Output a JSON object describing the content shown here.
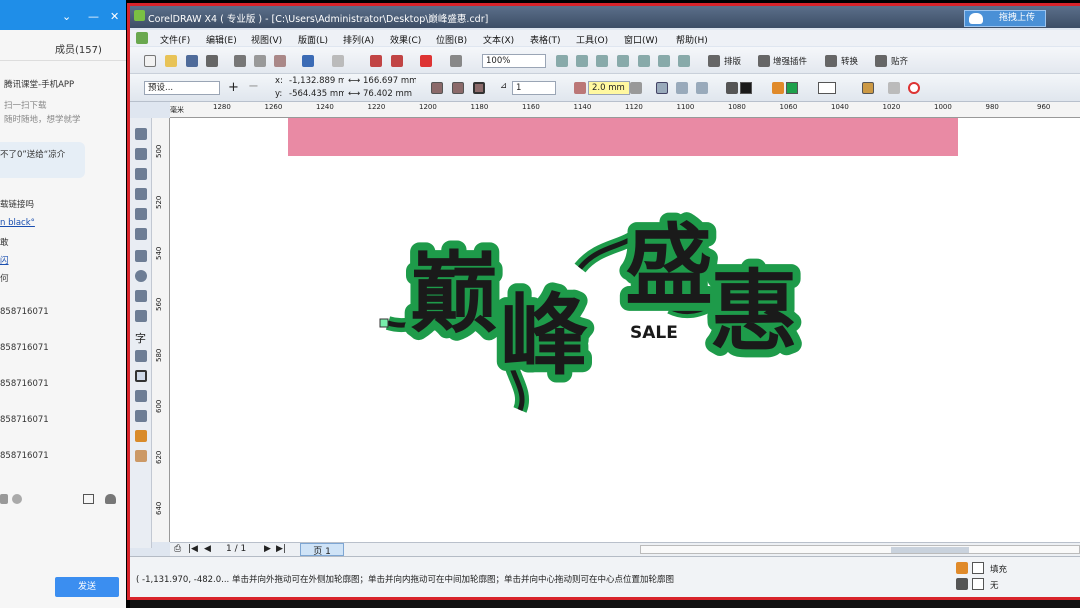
{
  "chat": {
    "members": "成员(157)",
    "lines": [
      {
        "text": "腾讯课堂-手机APP",
        "style": "normal"
      },
      {
        "text": "扫一扫下载",
        "style": "gray"
      },
      {
        "text": "随时随地，想学就学",
        "style": "gray"
      },
      {
        "text": "不了0”送给“凉介",
        "style": "normal"
      },
      {
        "text": "载链接吗",
        "style": "normal"
      },
      {
        "text": "n black°",
        "style": "link"
      },
      {
        "text": "敢",
        "style": "normal"
      },
      {
        "text": "闪",
        "style": "link"
      },
      {
        "text": "何",
        "style": "normal"
      },
      {
        "text": "858716071",
        "style": "normal"
      },
      {
        "text": "858716071",
        "style": "normal"
      },
      {
        "text": "858716071",
        "style": "normal"
      },
      {
        "text": "858716071",
        "style": "normal"
      },
      {
        "text": "858716071",
        "style": "normal"
      }
    ],
    "send_label": "发送"
  },
  "window": {
    "title": "CorelDRAW X4 ( 专业版 ) - [C:\\Users\\Administrator\\Desktop\\巅峰盛惠.cdr]",
    "upload_label": "拖拽上传"
  },
  "menu": [
    "文件(F)",
    "编辑(E)",
    "视图(V)",
    "版面(L)",
    "排列(A)",
    "效果(C)",
    "位图(B)",
    "文本(X)",
    "表格(T)",
    "工具(O)",
    "窗口(W)",
    "帮助(H)"
  ],
  "toolbar": {
    "zoom": "100%",
    "plugins": [
      "排版",
      "增强插件",
      "转换",
      "贴齐"
    ]
  },
  "propbar": {
    "preset": "预设...",
    "x": "-1,132.889 mm",
    "y": "-564.435 mm",
    "width": "166.697 mm",
    "height": "76.402 mm",
    "steps": "1",
    "offset": "2.0 mm",
    "x_label": "x:",
    "y_label": "y:"
  },
  "ruler": {
    "h_ticks": [
      "1280",
      "1260",
      "1240",
      "1220",
      "1200",
      "1180",
      "1160",
      "1140",
      "1120",
      "1100",
      "1080",
      "1060",
      "1040",
      "1020",
      "1000",
      "980",
      "960"
    ],
    "h_unit": "毫米",
    "v_ticks": [
      "500",
      "520",
      "540",
      "560",
      "580",
      "600",
      "620",
      "640"
    ]
  },
  "artwork": {
    "chars": [
      "巅",
      "峰",
      "盛",
      "惠"
    ],
    "sale": "SALE",
    "fill": "#1a1a1a",
    "outline": "#1e9b4a",
    "banner": "#e98aa4"
  },
  "pagebar": {
    "counter": "1 / 1",
    "page_tab": "页 1"
  },
  "status": {
    "text": "( -1,131.970, -482.0... 单击并向外拖动可在外侧加轮廓图；单击并向内拖动可在中间加轮廓图；单击并向中心拖动则可在中心点位置加轮廓图",
    "fill_label": "填充",
    "outline_label": "无"
  }
}
